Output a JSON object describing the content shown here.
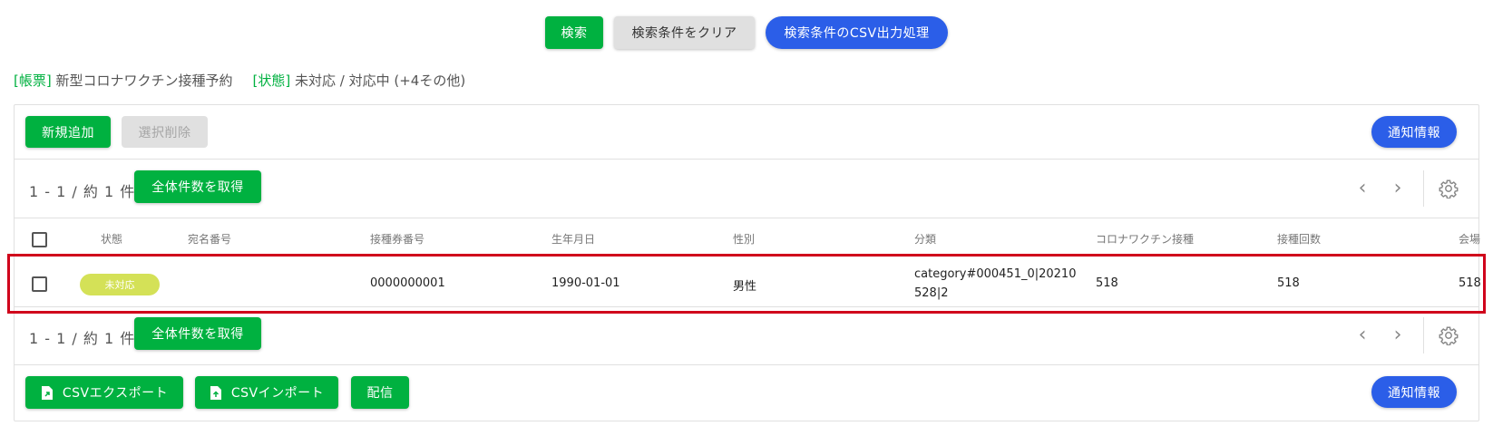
{
  "toolbar": {
    "search_label": "検索",
    "clear_label": "検索条件をクリア",
    "csv_output_label": "検索条件のCSV出力処理"
  },
  "filters": {
    "form_tag": "[帳票]",
    "form_value": "新型コロナワクチン接種予約",
    "status_tag": "[状態]",
    "status_value": "未対応 / 対応中 (+4その他)"
  },
  "actions": {
    "add_label": "新規追加",
    "delete_label": "選択削除",
    "notify_label": "通知情報"
  },
  "pagination": {
    "count_text": "1 - 1 / 約 1 件",
    "get_total_label": "全体件数を取得"
  },
  "table": {
    "columns": [
      "状態",
      "宛名番号",
      "接種券番号",
      "生年月日",
      "性別",
      "分類",
      "コロナワクチン接種",
      "接種回数",
      "会場"
    ],
    "rows": [
      {
        "status": "未対応",
        "address_number": "",
        "ticket_number": "0000000001",
        "birth_date": "1990-01-01",
        "gender": "男性",
        "category_line1": "category#000451_0|20210",
        "category_line2": "528|2",
        "vaccination": "518",
        "count": "518",
        "venue": "518"
      }
    ]
  },
  "footer_actions": {
    "csv_export_label": "CSVエクスポート",
    "csv_import_label": "CSVインポート",
    "deliver_label": "配信",
    "notify_label": "通知情報"
  },
  "colors": {
    "green": "#00b140",
    "blue": "#2b5ee8",
    "badge": "#d4e157",
    "highlight": "#d0021b"
  }
}
